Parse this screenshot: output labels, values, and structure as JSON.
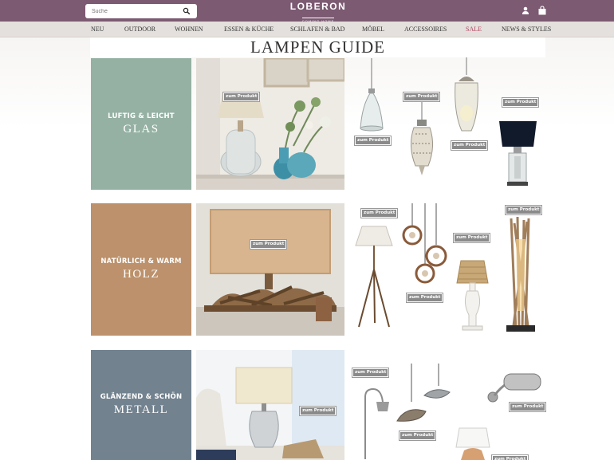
{
  "header": {
    "brand": "LOBERON",
    "tagline": "COMING HOME",
    "search_placeholder": "Suche",
    "bg_color": "#7c5a72"
  },
  "nav": {
    "items": [
      "NEU",
      "OUTDOOR",
      "WOHNEN",
      "ESSEN & KÜCHE",
      "SCHLAFEN & BAD",
      "MÖBEL",
      "ACCESSOIRES",
      "SALE",
      "NEWS & STYLES"
    ],
    "sale_color": "#b0425e"
  },
  "page": {
    "title": "LAMPEN GUIDE"
  },
  "badge_label": "zum Produkt",
  "sections": [
    {
      "subtitle": "LUFTIG & LEICHT",
      "material": "GLAS",
      "color": "#95b1a4"
    },
    {
      "subtitle": "NATÜRLICH & WARM",
      "material": "HOLZ",
      "color": "#bc916b"
    },
    {
      "subtitle": "GLÄNZEND & SCHÖN",
      "material": "METALL",
      "color": "#72828f"
    }
  ]
}
